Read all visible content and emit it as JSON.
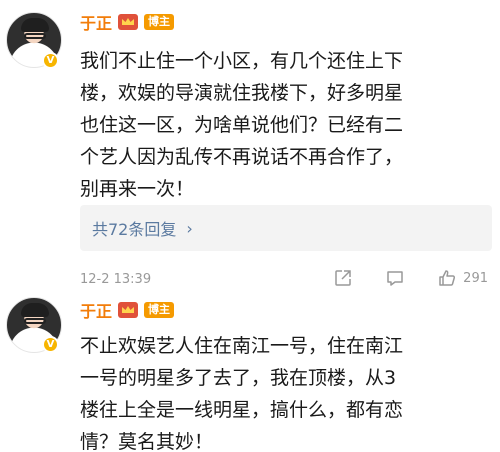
{
  "comments": [
    {
      "username": "于正",
      "badge": "博主",
      "verified_mark": "V",
      "content_lines": [
        "我们不止住一个小区，有几个还住上下",
        "楼，欢娱的导演就住我楼下，好多明星",
        "也住这一区，为啥单说他们？已经有二",
        "个艺人因为乱传不再说话不再合作了，",
        "别再来一次！"
      ],
      "replies_label": "共72条回复",
      "replies_chevron": "›",
      "timestamp": "12-2 13:39",
      "like_count": "291"
    },
    {
      "username": "于正",
      "badge": "博主",
      "verified_mark": "V",
      "content_lines": [
        "不止欢娱艺人住在南江一号，住在南江",
        "一号的明星多了去了，我在顶楼，从3",
        "楼往上全是一线明星，搞什么，都有恋",
        "情？莫名其妙！"
      ]
    }
  ],
  "icons": {
    "crown": "crown-icon",
    "share": "share-icon",
    "comment": "comment-icon",
    "like": "thumbs-up-icon",
    "replies_arrow": "chevron-right-icon"
  },
  "colors": {
    "username": "#f27d0a",
    "badge": "#f59a00",
    "verified": "#f7b500",
    "link": "#5b7aa0",
    "meta": "#999999"
  }
}
